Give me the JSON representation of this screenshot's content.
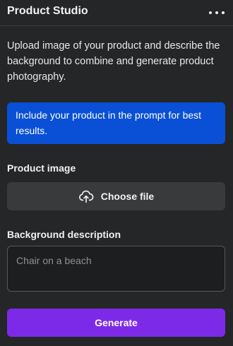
{
  "header": {
    "title": "Product Studio",
    "more_icon": "more-horizontal-icon"
  },
  "description": "Upload image of your product and describe the background to combine and generate product photography.",
  "info_banner": {
    "text": "Include your product in the prompt for best results.",
    "color": "#0a50d6"
  },
  "product_image": {
    "label": "Product image",
    "button_label": "Choose file",
    "icon": "cloud-upload-icon"
  },
  "background": {
    "label": "Background description",
    "placeholder": "Chair on a beach",
    "value": ""
  },
  "generate": {
    "label": "Generate",
    "color": "#7d2ae8"
  }
}
